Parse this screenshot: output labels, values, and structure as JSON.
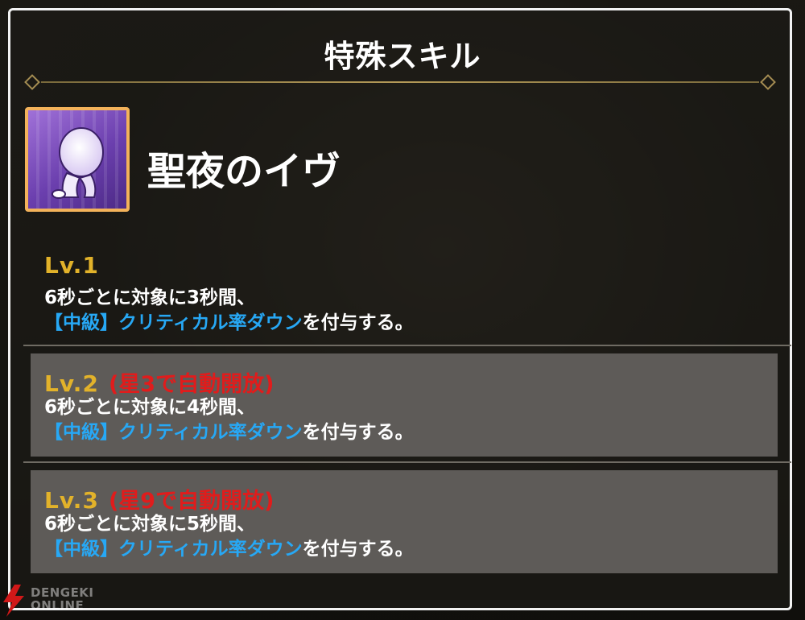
{
  "dialog": {
    "title": "特殊スキル"
  },
  "skill": {
    "name": "聖夜のイヴ",
    "icon": "crouching-figure-icon",
    "icon_colors": {
      "frame": "#f3b25a",
      "background": "#7a4cc4"
    }
  },
  "levels": [
    {
      "name": "Lv.1",
      "unlock": "",
      "line1": "6秒ごとに対象に3秒間、",
      "effect": "【中級】クリティカル率ダウン",
      "suffix": "を付与する。"
    },
    {
      "name": "Lv.2",
      "unlock": "(星3で自動開放)",
      "line1": "6秒ごとに対象に4秒間、",
      "effect": "【中級】クリティカル率ダウン",
      "suffix": "を付与する。"
    },
    {
      "name": "Lv.3",
      "unlock": "(星9で自動開放)",
      "line1": "6秒ごとに対象に5秒間、",
      "effect": "【中級】クリティカル率ダウン",
      "suffix": "を付与する。"
    }
  ],
  "watermark": {
    "line1": "DENGEKI",
    "line2": "ONLINE"
  },
  "colors": {
    "level_label": "#e2b22a",
    "unlock_text": "#e01c1c",
    "effect_text": "#27a8f5",
    "locked_panel": "#5e5b58",
    "divider_gold": "#b49a58"
  }
}
